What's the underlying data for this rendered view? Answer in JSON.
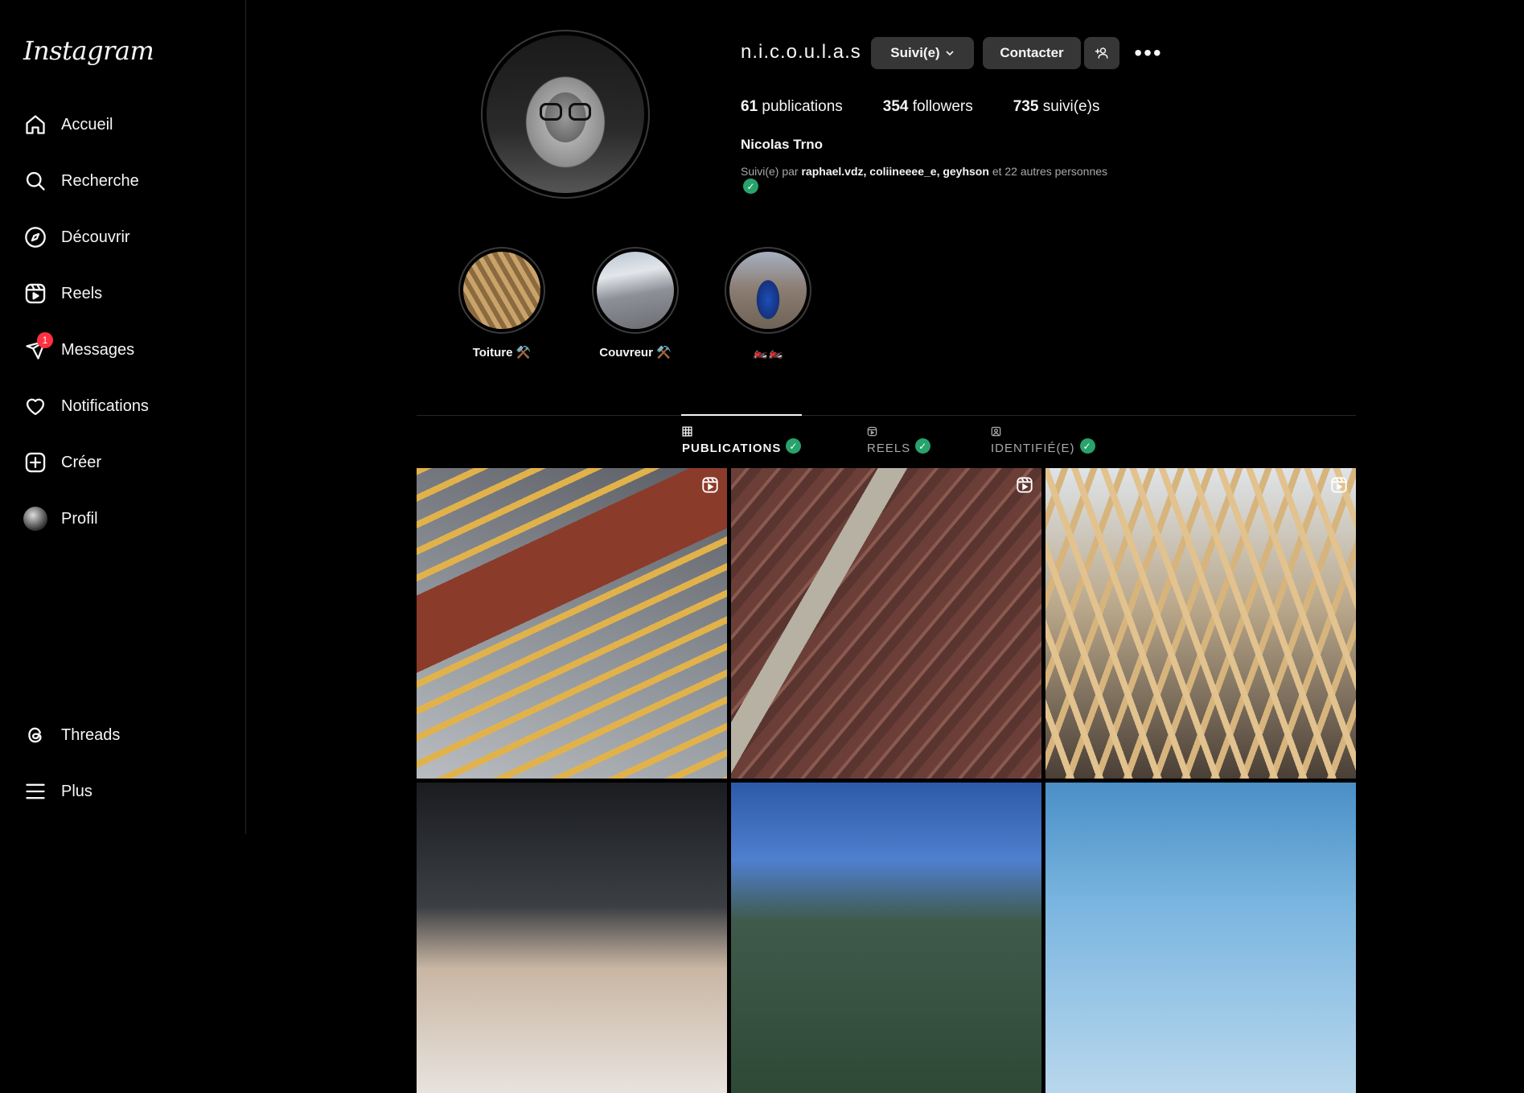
{
  "brand": {
    "logo_text": "Instagram"
  },
  "sidebar": {
    "items": [
      {
        "label": "Accueil",
        "icon": "home-icon"
      },
      {
        "label": "Recherche",
        "icon": "search-icon"
      },
      {
        "label": "Découvrir",
        "icon": "compass-icon"
      },
      {
        "label": "Reels",
        "icon": "reels-icon"
      },
      {
        "label": "Messages",
        "icon": "messages-icon",
        "badge": "1"
      },
      {
        "label": "Notifications",
        "icon": "heart-icon"
      },
      {
        "label": "Créer",
        "icon": "create-icon"
      },
      {
        "label": "Profil",
        "icon": "avatar"
      }
    ],
    "bottom_items": [
      {
        "label": "Threads",
        "icon": "threads-icon"
      },
      {
        "label": "Plus",
        "icon": "menu-icon"
      }
    ]
  },
  "profile": {
    "username": "n.i.c.o.u.l.a.s",
    "follow_button": "Suivi(e)",
    "contact_button": "Contacter",
    "stats": {
      "posts_count": "61",
      "posts_label": "publications",
      "followers_count": "354",
      "followers_label": "followers",
      "following_count": "735",
      "following_label": "suivi(e)s"
    },
    "full_name": "Nicolas Trno",
    "followed_by": {
      "prefix": "Suivi(e) par",
      "names": "raphael.vdz, coliineeee_e, geyhson",
      "suffix": "et 22 autres personnes"
    }
  },
  "highlights": [
    {
      "label": "Toiture ⚒️"
    },
    {
      "label": "Couvreur ⚒️"
    },
    {
      "label": "🏍️🏍️"
    }
  ],
  "tabs": [
    {
      "label": "PUBLICATIONS",
      "icon": "grid-icon",
      "active": true
    },
    {
      "label": "REELS",
      "icon": "reels-icon",
      "active": false
    },
    {
      "label": "IDENTIFIÉ(E)",
      "icon": "tagged-icon",
      "active": false
    }
  ],
  "posts": [
    {
      "type": "reel"
    },
    {
      "type": "reel"
    },
    {
      "type": "reel"
    },
    {
      "type": "image"
    },
    {
      "type": "image"
    },
    {
      "type": "image"
    }
  ],
  "colors": {
    "background": "#000000",
    "button": "#363636",
    "badge": "#ff3040",
    "check": "#27a36b",
    "muted": "#a8a8a8"
  }
}
